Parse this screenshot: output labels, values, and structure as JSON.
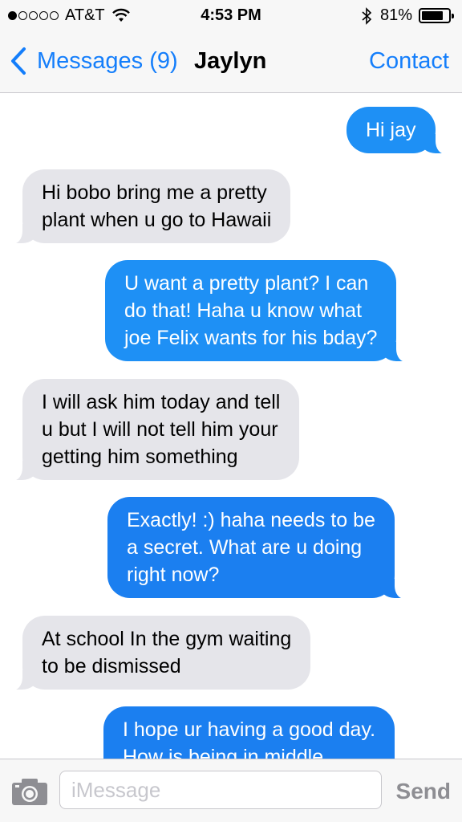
{
  "status_bar": {
    "carrier": "AT&T",
    "signal_bars_filled": 1,
    "signal_bars_total": 5,
    "time": "4:53 PM",
    "battery_percent": "81%",
    "battery_level": 0.81
  },
  "nav": {
    "back_label": "Messages (9)",
    "contact_name": "Jaylyn",
    "contact_button": "Contact"
  },
  "messages": [
    {
      "direction": "outgoing",
      "lines": [
        "Hi jay"
      ]
    },
    {
      "direction": "incoming",
      "lines": [
        "Hi bobo bring me a pretty",
        "plant when u go to Hawaii"
      ]
    },
    {
      "direction": "outgoing",
      "lines": [
        "U want a pretty plant? I can",
        "do that! Haha u know what",
        "joe Felix wants for his bday?"
      ]
    },
    {
      "direction": "incoming",
      "lines": [
        "I will ask him today and tell",
        "u but I will not tell him your",
        "getting him something"
      ]
    },
    {
      "direction": "outgoing",
      "lines": [
        "Exactly! :) haha needs to be",
        "a secret. What are u doing",
        "right now?"
      ]
    },
    {
      "direction": "incoming",
      "lines": [
        "At school In the gym waiting",
        "to be dismissed"
      ]
    },
    {
      "direction": "outgoing",
      "lines": [
        "I hope ur having a good day.",
        "How is being in middle"
      ]
    }
  ],
  "input": {
    "placeholder": "iMessage",
    "send_label": "Send"
  },
  "colors": {
    "accent": "#147efb",
    "outgoing_bubble": "#1e90f5",
    "incoming_bubble": "#e5e5ea",
    "bar_background": "#f7f7f7"
  },
  "icons": {
    "signal": "signal-dots-icon",
    "wifi": "wifi-icon",
    "bluetooth": "bluetooth-icon",
    "battery": "battery-icon",
    "back": "chevron-left-icon",
    "camera": "camera-icon"
  }
}
